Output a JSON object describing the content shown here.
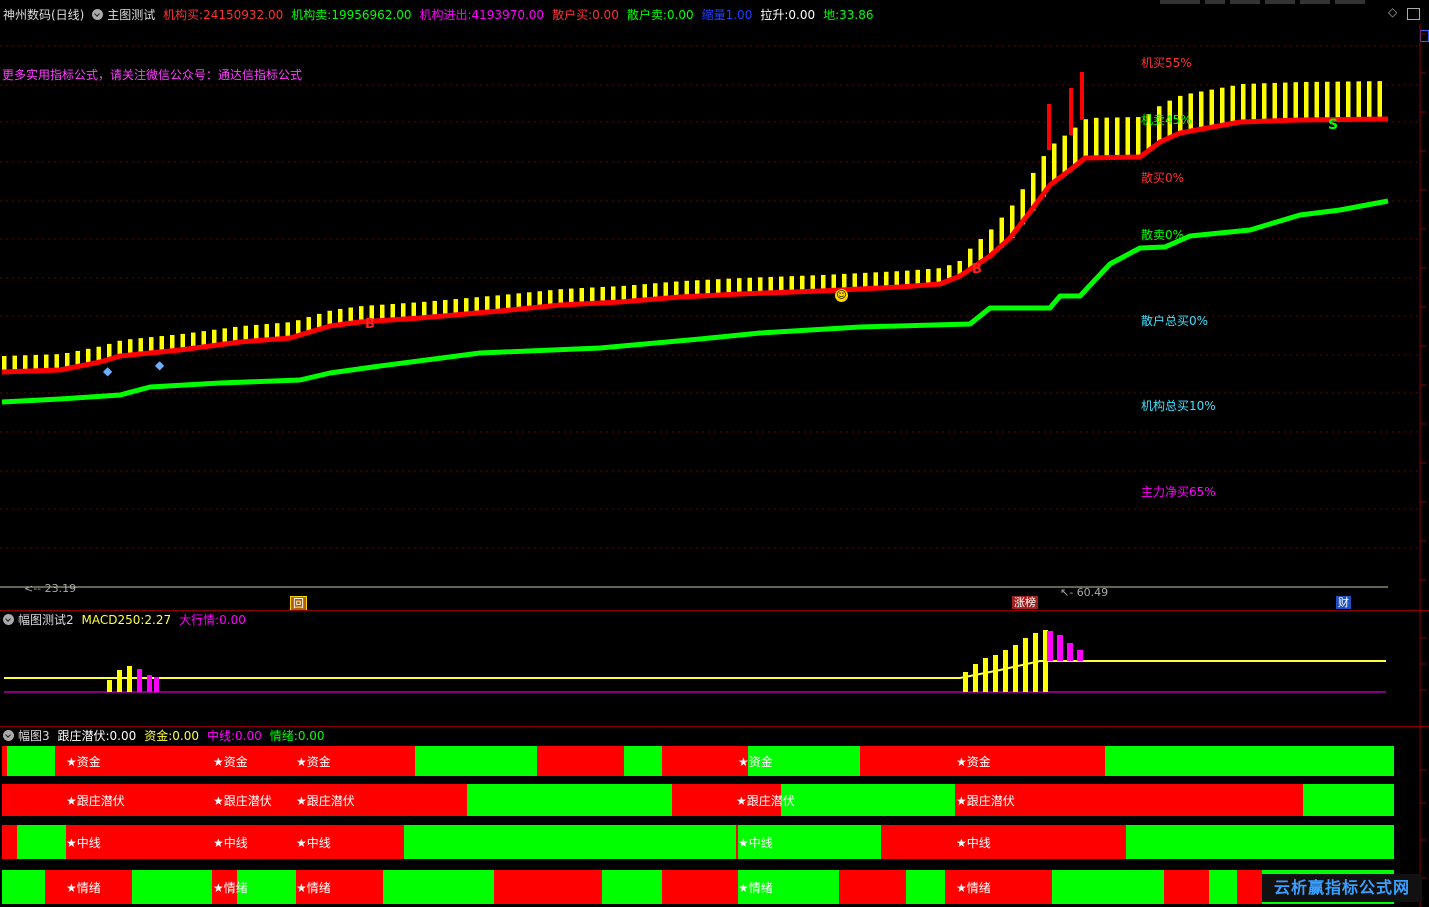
{
  "colors": {
    "background": "#000000",
    "red": "#ff0000",
    "green": "#00ff00",
    "yellow": "#ffff00",
    "magenta": "#ff00ff",
    "cyan": "#40e0ff",
    "separator": "#8b0000"
  },
  "main_panel": {
    "stock_name": "神州数码(日线)",
    "indicator_name": "主图测试",
    "legend": [
      {
        "label": "机构买:",
        "value": "24150932.00",
        "color": "#ff3030"
      },
      {
        "label": "机构卖:",
        "value": "19956962.00",
        "color": "#00ff00"
      },
      {
        "label": "机构进出:",
        "value": "4193970.00",
        "color": "#ff00ff"
      },
      {
        "label": "散户买:",
        "value": "0.00",
        "color": "#ff3030"
      },
      {
        "label": "散户卖:",
        "value": "0.00",
        "color": "#00ff00"
      },
      {
        "label": "缩量",
        "value": "1.00",
        "color": "#2040ff"
      },
      {
        "label": "拉升:",
        "value": "0.00",
        "color": "#ffffff"
      },
      {
        "label": "地:",
        "value": "33.86",
        "color": "#00ff00"
      }
    ],
    "promo_text": "更多实用指标公式，请关注微信公众号：通达信指标公式",
    "right_labels": [
      {
        "text": "机买55%",
        "color": "#ff3030"
      },
      {
        "text": "机卖45%",
        "color": "#00ff00"
      },
      {
        "text": "散买0%",
        "color": "#ff3030"
      },
      {
        "text": "散卖0%",
        "color": "#00ff00"
      },
      {
        "text": "散户总买0%",
        "color": "#40e0ff"
      },
      {
        "text": "机构总买10%",
        "color": "#40e0ff"
      },
      {
        "text": "主力净买65%",
        "color": "#ff00ff"
      }
    ],
    "markers": {
      "buy": "B",
      "sell": "S",
      "smile_icon": "smiley-icon",
      "diamond_icon": "diamond-icon"
    },
    "low_price": "23.19",
    "high_price": "60.49",
    "bottom_badges": [
      "回",
      "涨榜",
      "财"
    ]
  },
  "sub_panel_2": {
    "title": "幅图测试2",
    "legend": [
      {
        "label": "MACD250:",
        "value": "2.27",
        "color": "#ffff40"
      },
      {
        "label": "大行情:",
        "value": "0.00",
        "color": "#ff00ff"
      }
    ]
  },
  "sub_panel_3": {
    "title": "幅图3",
    "legend": [
      {
        "label": "跟庄潜伏:",
        "value": "0.00",
        "color": "#ffffff"
      },
      {
        "label": "资金:",
        "value": "0.00",
        "color": "#ffff40"
      },
      {
        "label": "中线:",
        "value": "0.00",
        "color": "#ff00ff"
      },
      {
        "label": "情绪:",
        "value": "0.00",
        "color": "#00ff00"
      }
    ],
    "rows": [
      {
        "name": "资金",
        "star_label": "★资金"
      },
      {
        "name": "跟庄潜伏",
        "star_label": "★跟庄潜伏"
      },
      {
        "name": "中线",
        "star_label": "★中线"
      },
      {
        "name": "情绪",
        "star_label": "★情绪"
      }
    ]
  },
  "watermark": "云析赢指标公式网"
}
